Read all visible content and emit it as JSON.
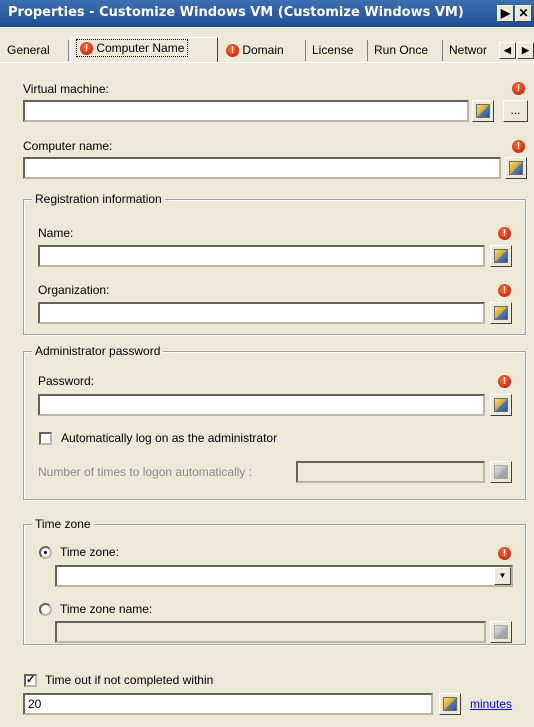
{
  "window": {
    "title": "Properties - Customize Windows VM (Customize Windows VM)",
    "help_glyph": "▶",
    "close_glyph": "✕"
  },
  "tabs": [
    {
      "label": "General",
      "active": false,
      "error": false
    },
    {
      "label": "Computer Name",
      "active": true,
      "error": true
    },
    {
      "label": "Domain",
      "active": false,
      "error": true
    },
    {
      "label": "License",
      "active": false,
      "error": false
    },
    {
      "label": "Run Once",
      "active": false,
      "error": false
    },
    {
      "label": "Networ",
      "active": false,
      "error": false
    }
  ],
  "tab_scroll": {
    "left": "◀",
    "right": "▶"
  },
  "error_glyph": "!",
  "virtual_machine": {
    "label": "Virtual machine:",
    "value": "",
    "browse_label": "..."
  },
  "computer_name": {
    "label": "Computer name:",
    "value": ""
  },
  "registration": {
    "title": "Registration information",
    "name_label": "Name:",
    "name_value": "",
    "org_label": "Organization:",
    "org_value": ""
  },
  "admin": {
    "title": "Administrator password",
    "password_label": "Password:",
    "password_value": "",
    "autologon_label": "Automatically log on as the administrator",
    "autologon_checked": false,
    "times_label": "Number of times to logon automatically :",
    "times_value": ""
  },
  "timezone": {
    "title": "Time zone",
    "tz_radio_label": "Time zone:",
    "tz_selected": true,
    "tz_value": "",
    "tz_arrow": "▼",
    "tzname_radio_label": "Time zone name:",
    "tzname_value": ""
  },
  "timeout": {
    "checkbox_label": "Time out if not completed within",
    "checked": true,
    "check_glyph": "✓",
    "value": "20",
    "unit_link": "minutes"
  }
}
